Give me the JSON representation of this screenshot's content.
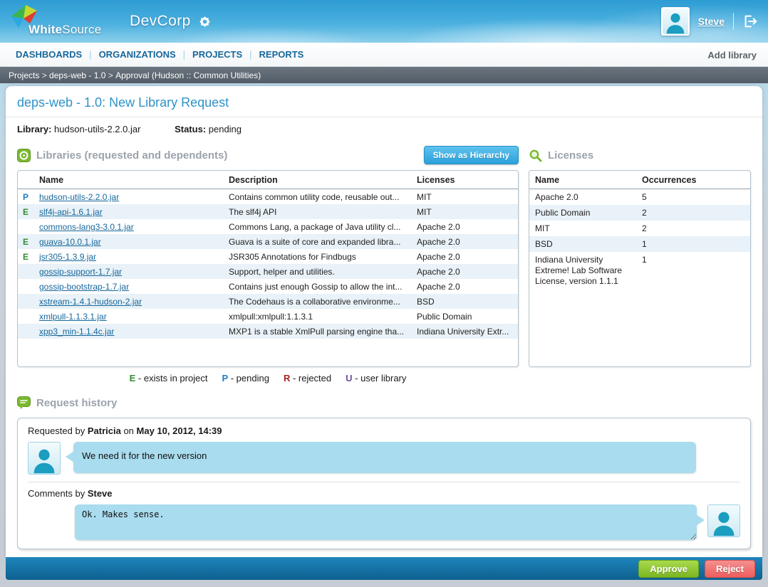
{
  "header": {
    "brand_white": "White",
    "brand_source": "Source",
    "app_title": "DevCorp",
    "user_name": "Steve"
  },
  "icons": {
    "gear-icon": "star-gear",
    "logout-icon": "exit-door-arrow",
    "libraries-icon": "green-disc-square",
    "licenses-icon": "green-magnifier",
    "history-icon": "green-speech-bubble",
    "avatar-icon": "person-silhouette"
  },
  "colors": {
    "header_sky": "#3fa6d8",
    "nav_link": "#17679b",
    "breadcrumb_bg": "#5d6772",
    "page_title": "#2e93c8",
    "panel_title": "#9ba3ab",
    "hierarchy_button": "#2aa2db",
    "row_alt": "#e9f2f8",
    "bubble": "#a9dcee",
    "approve": "#7cb621",
    "reject": "#ee5e5e",
    "flag_E": "#2f8f2f",
    "flag_P": "#1f7dc2"
  },
  "nav": {
    "items": [
      {
        "label": "DASHBOARDS"
      },
      {
        "label": "ORGANIZATIONS"
      },
      {
        "label": "PROJECTS"
      },
      {
        "label": "REPORTS"
      }
    ],
    "add_library_label": "Add library"
  },
  "breadcrumb": {
    "parts": [
      "Projects",
      "deps-web - 1.0",
      "Approval (Hudson :: Common Utilities)"
    ],
    "separator": " > "
  },
  "page": {
    "title": "deps-web - 1.0: New Library Request",
    "library_label": "Library:",
    "library_value": "hudson-utils-2.2.0.jar",
    "status_label": "Status:",
    "status_value": "pending"
  },
  "libraries_panel": {
    "title": "Libraries (requested and dependents)",
    "hierarchy_button": "Show as Hierarchy",
    "columns": [
      "Name",
      "Description",
      "Licenses"
    ],
    "rows": [
      {
        "flag": "P",
        "name": "hudson-utils-2.2.0.jar",
        "description": "Contains common utility code, reusable out...",
        "license": "MIT"
      },
      {
        "flag": "E",
        "name": "slf4j-api-1.6.1.jar",
        "description": "The slf4j API",
        "license": "MIT"
      },
      {
        "flag": "",
        "name": "commons-lang3-3.0.1.jar",
        "description": "Commons Lang, a package of Java utility cl...",
        "license": "Apache 2.0"
      },
      {
        "flag": "E",
        "name": "guava-10.0.1.jar",
        "description": "Guava is a suite of core and expanded libra...",
        "license": "Apache 2.0"
      },
      {
        "flag": "E",
        "name": "jsr305-1.3.9.jar",
        "description": "JSR305 Annotations for Findbugs",
        "license": "Apache 2.0"
      },
      {
        "flag": "",
        "name": "gossip-support-1.7.jar",
        "description": "Support, helper and utilities.",
        "license": "Apache 2.0"
      },
      {
        "flag": "",
        "name": "gossip-bootstrap-1.7.jar",
        "description": "Contains just enough Gossip to allow the int...",
        "license": "Apache 2.0"
      },
      {
        "flag": "",
        "name": "xstream-1.4.1-hudson-2.jar",
        "description": "The Codehaus is a collaborative environme...",
        "license": "BSD"
      },
      {
        "flag": "",
        "name": "xmlpull-1.1.3.1.jar",
        "description": "xmlpull:xmlpull:1.1.3.1",
        "license": "Public Domain"
      },
      {
        "flag": "",
        "name": "xpp3_min-1.1.4c.jar",
        "description": "MXP1 is a stable XmlPull parsing engine tha...",
        "license": "Indiana University Extr..."
      }
    ]
  },
  "legend": [
    {
      "letter": "E",
      "label": " - exists in project",
      "color": "#2f8f2f"
    },
    {
      "letter": "P",
      "label": " - pending",
      "color": "#1f7dc2"
    },
    {
      "letter": "R",
      "label": " - rejected",
      "color": "#a32222"
    },
    {
      "letter": "U",
      "label": " - user library",
      "color": "#6f4f9e"
    }
  ],
  "licenses_panel": {
    "title": "Licenses",
    "columns": [
      "Name",
      "Occurrences"
    ],
    "rows": [
      {
        "name": "Apache 2.0",
        "occurrences": "5"
      },
      {
        "name": "Public Domain",
        "occurrences": "2"
      },
      {
        "name": "MIT",
        "occurrences": "2"
      },
      {
        "name": "BSD",
        "occurrences": "1"
      },
      {
        "name": "Indiana University Extreme! Lab Software License, version 1.1.1",
        "occurrences": "1"
      }
    ]
  },
  "history_panel": {
    "title": "Request history",
    "requested_prefix": "Requested by ",
    "requester": "Patricia",
    "on_text": " on ",
    "request_date": "May 10, 2012, 14:39",
    "request_message": "We need it for the new version",
    "comments_prefix": "Comments by ",
    "commenter": "Steve",
    "comment_value": "Ok. Makes sense."
  },
  "footer": {
    "approve_label": "Approve",
    "reject_label": "Reject"
  }
}
